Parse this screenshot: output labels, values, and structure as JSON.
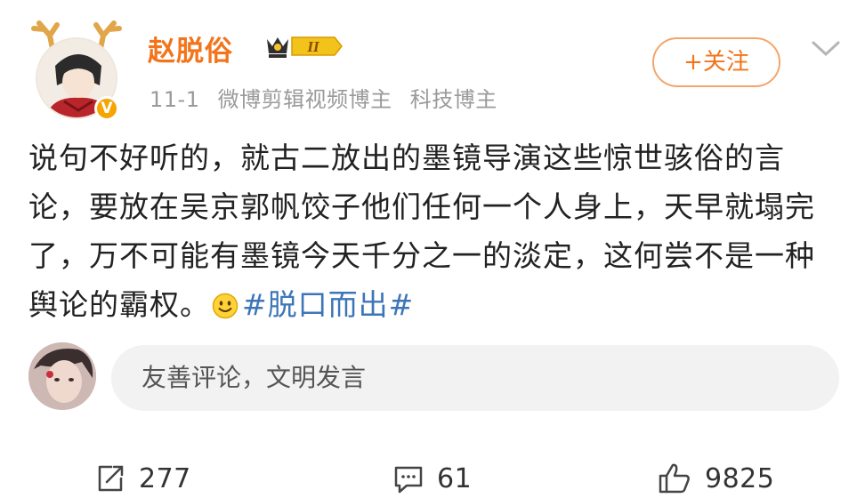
{
  "post": {
    "author": {
      "name": "赵脱俗",
      "vip_level": "II",
      "verified_mark": "V"
    },
    "meta": {
      "date": "11-1",
      "tags": [
        "微博剪辑视频博主",
        "科技博主"
      ]
    },
    "follow_label": "+关注",
    "text_main": "说句不好听的，就古二放出的墨镜导演这些惊世骇俗的言论，要放在吴京郭帆饺子他们任何一个人身上，天早就塌完了，万不可能有墨镜今天千分之一的淡定，这何尝不是一种舆论的霸权。",
    "emoji_icon": "smile-emoji",
    "hashtag": "#脱口而出#"
  },
  "comment_input": {
    "placeholder": "友善评论，文明发言"
  },
  "actions": {
    "repost_count": "277",
    "comment_count": "61",
    "like_count": "9825"
  },
  "colors": {
    "username": "#f2741b",
    "hashtag": "#3d76b8",
    "meta": "#9a9a9a",
    "verified_badge": "#f6a400"
  }
}
